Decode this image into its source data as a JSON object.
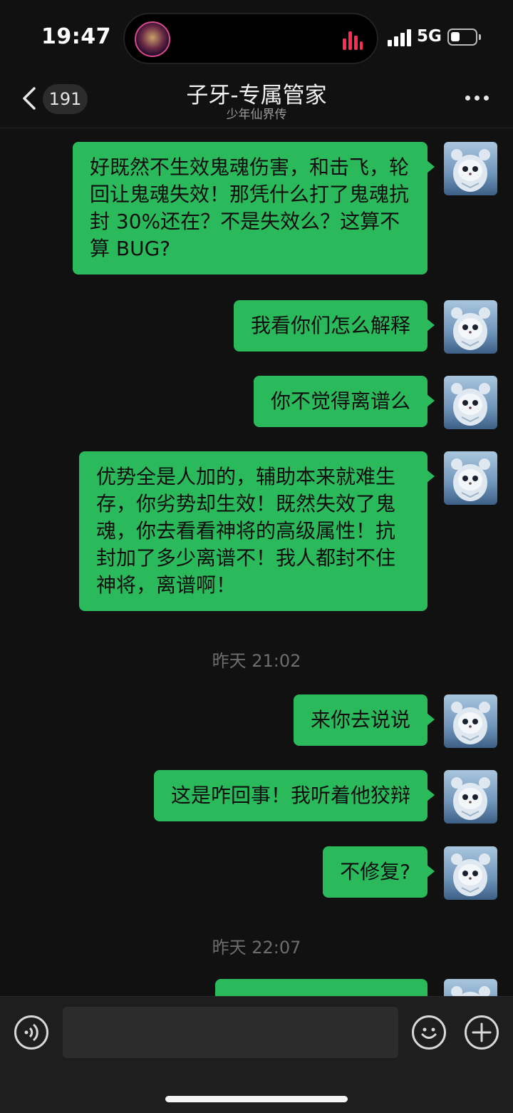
{
  "status_bar": {
    "time": "19:47",
    "network": "5G"
  },
  "header": {
    "unread_count": "191",
    "title": "子牙-专属管家",
    "subtitle": "少年仙界传",
    "back_icon": "chevron-left-icon",
    "more_icon": "more-dots-icon"
  },
  "messages": [
    {
      "type": "text",
      "text": "好既然不生效鬼魂伤害，和击飞，轮回让鬼魂失效！那凭什么打了鬼魂抗封 30%还在？不是失效么？这算不算 BUG?"
    },
    {
      "type": "text",
      "text": "我看你们怎么解释"
    },
    {
      "type": "text",
      "text": "你不觉得离谱么"
    },
    {
      "type": "text",
      "text": "优势全是人加的，辅助本来就难生存，你劣势却生效！既然失效了鬼魂，你去看看神将的高级属性！抗封加了多少离谱不！我人都封不住神将，离谱啊！"
    },
    {
      "type": "timestamp",
      "text": "昨天 21:02"
    },
    {
      "type": "text",
      "text": "来你去说说"
    },
    {
      "type": "text",
      "text": "这是咋回事！我听着他狡辩"
    },
    {
      "type": "text",
      "text": "不修复?"
    },
    {
      "type": "timestamp",
      "text": "昨天 22:07"
    }
  ],
  "input_bar": {
    "voice_icon": "voice-icon",
    "emoji_icon": "emoji-icon",
    "plus_icon": "plus-icon"
  },
  "colors": {
    "bubble": "#2bba5b",
    "background": "#111111"
  }
}
